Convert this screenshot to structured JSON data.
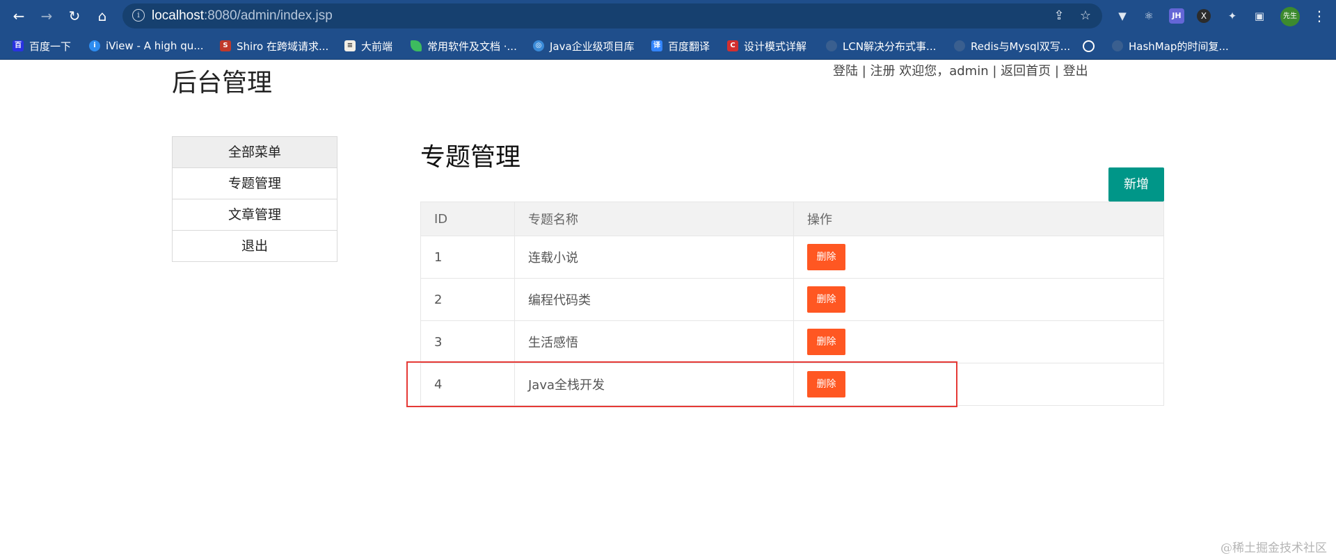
{
  "browser": {
    "url_host": "localhost",
    "url_rest": ":8080/admin/index.jsp",
    "nav": {
      "back": "←",
      "forward": "→",
      "reload": "↻",
      "home": "⌂"
    },
    "icons": [
      "info-icon",
      "share-icon",
      "star-icon",
      "extension-icons",
      "puzzle-icon",
      "sidebar-icon"
    ],
    "ext_jh": "JH",
    "ext_x": "X",
    "profile": "先生",
    "bookmarks": [
      {
        "label": "百度一下",
        "icon": "baidu-icon",
        "color": "#2932e1",
        "glyph": "百"
      },
      {
        "label": "iView - A high qu...",
        "icon": "iview-icon",
        "color": "#2d8cf0",
        "glyph": "i"
      },
      {
        "label": "Shiro 在跨域请求...",
        "icon": "shiro-icon",
        "color": "#c0392b",
        "glyph": "S"
      },
      {
        "label": "大前端",
        "icon": "book-icon",
        "color": "#e8e8e8",
        "glyph": "📖"
      },
      {
        "label": "常用软件及文档 ·...",
        "icon": "leaf-icon",
        "color": "#3dbb5f",
        "glyph": "◆"
      },
      {
        "label": "Java企业级项目库",
        "icon": "java-icon",
        "color": "#3b8bd8",
        "glyph": "◎"
      },
      {
        "label": "百度翻译",
        "icon": "translate-icon",
        "color": "#3385ff",
        "glyph": "译"
      },
      {
        "label": "设计模式详解",
        "icon": "c-icon",
        "color": "#d32f2f",
        "glyph": "C"
      },
      {
        "label": "LCN解决分布式事...",
        "icon": "github-icon",
        "color": "#1f4e8b",
        "glyph": "●"
      },
      {
        "label": "Redis与Mysql双写...",
        "icon": "github-icon",
        "color": "#1f4e8b",
        "glyph": "●"
      },
      {
        "label": "",
        "icon": "globe-icon",
        "color": "#1f4e8b",
        "glyph": "🌐"
      },
      {
        "label": "HashMap的时间复...",
        "icon": "github-icon",
        "color": "#1f4e8b",
        "glyph": "●"
      }
    ]
  },
  "header": {
    "site_title": "后台管理",
    "links": "登陆 | 注册 欢迎您，admin | 返回首页 | 登出"
  },
  "sidebar": {
    "items": [
      {
        "label": "全部菜单"
      },
      {
        "label": "专题管理"
      },
      {
        "label": "文章管理"
      },
      {
        "label": "退出"
      }
    ]
  },
  "main": {
    "title": "专题管理",
    "add_label": "新增",
    "columns": [
      "ID",
      "专题名称",
      "操作"
    ],
    "rows": [
      {
        "id": "1",
        "name": "连载小说",
        "action": "删除"
      },
      {
        "id": "2",
        "name": "编程代码类",
        "action": "删除"
      },
      {
        "id": "3",
        "name": "生活感悟",
        "action": "删除"
      },
      {
        "id": "4",
        "name": "Java全栈开发",
        "action": "删除"
      }
    ]
  },
  "watermark": "@稀土掘金技术社区",
  "colors": {
    "chrome": "#1f4e8b",
    "add_button": "#009688",
    "delete_button": "#ff5722",
    "highlight": "#e53935"
  }
}
